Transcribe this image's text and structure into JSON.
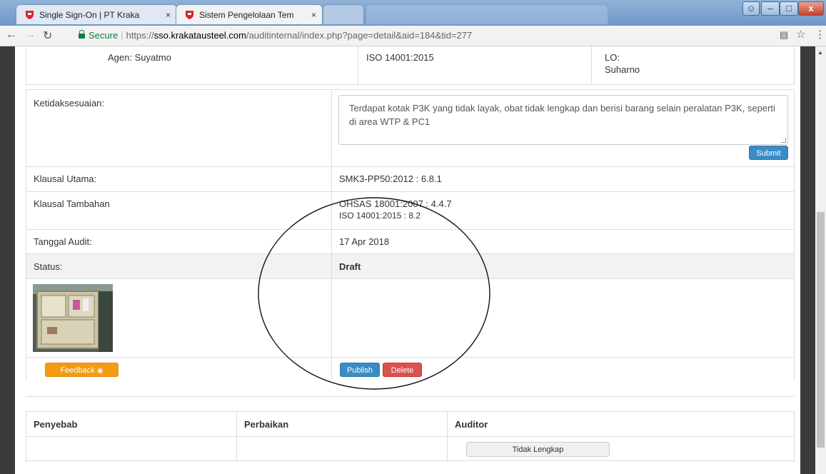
{
  "browser": {
    "tabs": [
      {
        "label": "Single Sign-On | PT Kraka",
        "close": "×"
      },
      {
        "label": "Sistem Pengelolaan Tem",
        "close": "×"
      }
    ],
    "address": {
      "secure_label": "Secure",
      "url_scheme": "https://",
      "url_host": "sso.krakatausteel.com",
      "url_path": "/auditinternal/index.php?page=detail&aid=184&tid=277"
    }
  },
  "header_row": {
    "agent": "Agen: Suyatmo",
    "standard": "ISO 14001:2015",
    "lo_label": "LO:",
    "lo_name": "Suharno"
  },
  "finding": {
    "label": "Ketidaksesuaian:",
    "text": "Terdapat kotak P3K yang tidak layak, obat tidak lengkap dan berisi barang selain peralatan P3K, seperti di area WTP & PC1",
    "submit_label": "Submit"
  },
  "details": {
    "klausal_utama_label": "Klausal Utama:",
    "klausal_utama_value": "SMK3-PP50:2012 : 6.8.1",
    "klausal_tambahan_label": "Klausal Tambahan",
    "klausal_tambahan_values": [
      "OHSAS 18001:2007 : 4.4.7",
      "ISO 14001:2015 : 8.2"
    ],
    "tanggal_label": "Tanggal Audit:",
    "tanggal_value": "17 Apr 2018",
    "status_label": "Status:",
    "status_value": "Draft"
  },
  "actions": {
    "feedback_label": "Feedback",
    "publish_label": "Publish",
    "delete_label": "Delete"
  },
  "bottom_table": {
    "headers": [
      "Penyebab",
      "Perbaikan",
      "Auditor"
    ],
    "auditor_button": "Tidak Lengkap"
  },
  "colors": {
    "primary": "#3a8cc4",
    "danger": "#d9534f",
    "warning": "#f39c12",
    "secure": "#0b8043"
  }
}
